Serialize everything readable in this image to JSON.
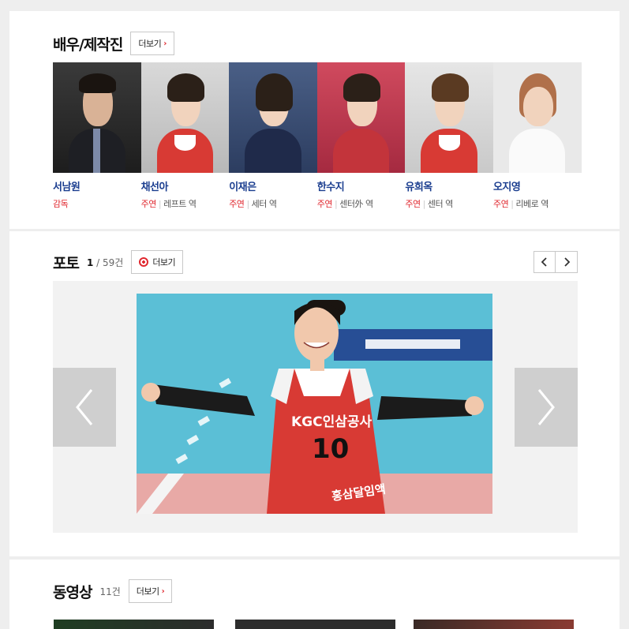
{
  "cast_section": {
    "title": "배우/제작진",
    "more_label": "더보기",
    "members": [
      {
        "name": "서남원",
        "type": "감독",
        "role": ""
      },
      {
        "name": "채선아",
        "type": "주연",
        "role": "레프트 역"
      },
      {
        "name": "이재은",
        "type": "주연",
        "role": "세터 역"
      },
      {
        "name": "한수지",
        "type": "주연",
        "role": "센터外 역"
      },
      {
        "name": "유희옥",
        "type": "주연",
        "role": "센터 역"
      },
      {
        "name": "오지영",
        "type": "주연",
        "role": "리베로 역"
      }
    ]
  },
  "photo_section": {
    "title": "포토",
    "current": "1",
    "total": "59건",
    "more_label": "더보기",
    "jersey_team": "KGC인삼공사",
    "jersey_number": "10",
    "jersey_sponsor": "홍삼달임액"
  },
  "video_section": {
    "title": "동영상",
    "count": "11건",
    "more_label": "더보기"
  },
  "colors": {
    "accent": "#e0282f",
    "name_blue": "#1a3d8f",
    "jersey_red": "#d83a34",
    "court_blue": "#5bbfd6"
  }
}
